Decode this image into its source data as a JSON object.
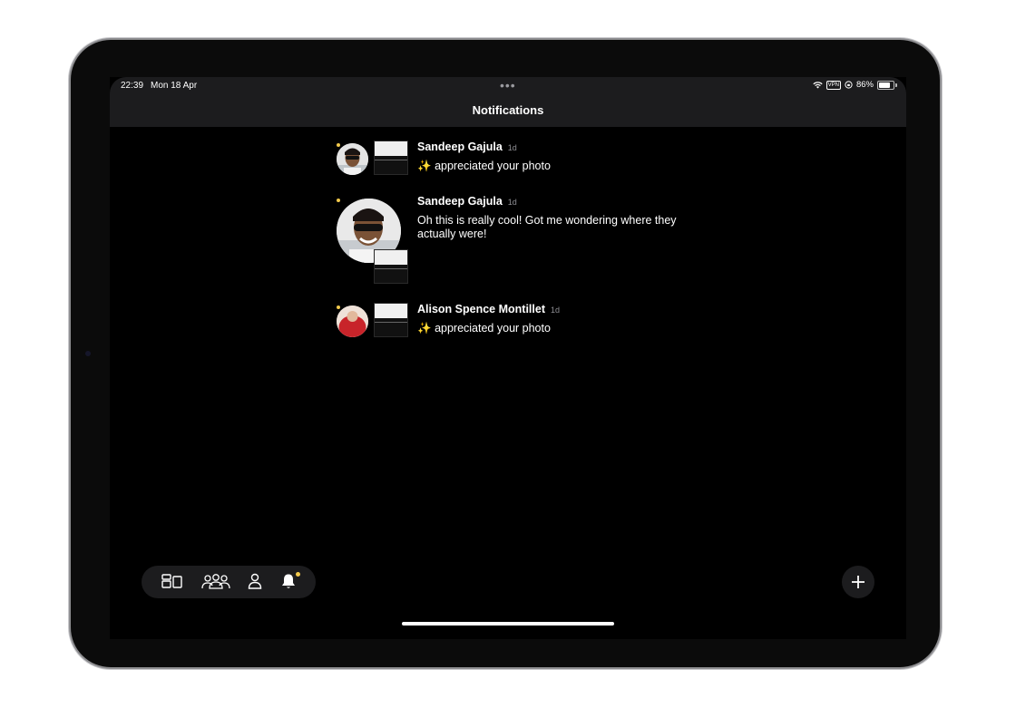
{
  "status_bar": {
    "time": "22:39",
    "date": "Mon 18 Apr",
    "multitask_dots": "•••",
    "vpn": "VPN",
    "battery": "86%"
  },
  "header": {
    "title": "Notifications"
  },
  "notifications": [
    {
      "name": "Sandeep Gajula",
      "ago": "1d",
      "emoji": "✨",
      "text": "appreciated your photo",
      "unread": true
    },
    {
      "name": "Sandeep Gajula",
      "ago": "1d",
      "text": "Oh this is really cool! Got me wondering where they actually were!",
      "unread": true
    },
    {
      "name": "Alison Spence Montillet",
      "ago": "1d",
      "emoji": "✨",
      "text": "appreciated your photo",
      "unread": true
    }
  ],
  "tab_bar": {
    "tabs": [
      {
        "icon": "feed-icon"
      },
      {
        "icon": "groups-icon"
      },
      {
        "icon": "profile-icon"
      },
      {
        "icon": "bell-icon",
        "badge": true
      }
    ]
  },
  "colors": {
    "accent": "#f2c94c",
    "background": "#000000",
    "bar": "#1c1c1e"
  }
}
